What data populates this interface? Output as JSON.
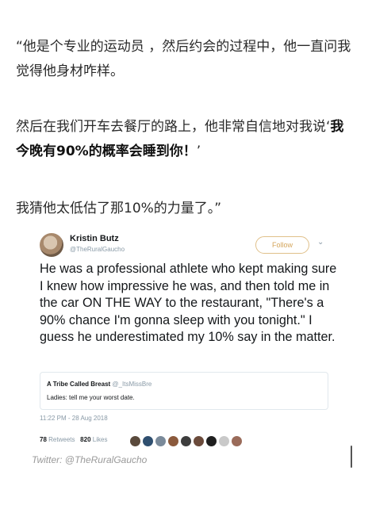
{
  "article": {
    "p1": "“他是个专业的运动员 ，然后约会的过程中，他一直问我觉得他身材咋样。",
    "p2_prefix": "然后在我们开车去餐厅的路上，他非常自信地对我说‘",
    "p2_bold": "我今晚有90%的概率会睡到你！",
    "p2_suffix": "’",
    "p3": "我猜他太低估了那10%的力量了。”"
  },
  "tweet": {
    "author_name": "Kristin Butz",
    "author_handle": "@TheRuralGaucho",
    "follow_label": "Follow",
    "text": "He was a professional athlete who kept making sure I knew how impressive he was, and then told me in the car ON THE WAY to the restaurant, \"There's a 90% chance I'm gonna sleep with you tonight.\" I guess he underestimated my 10% say in the matter.",
    "quoted": {
      "name": "A Tribe Called Breast",
      "handle": "@_ItsMissBre",
      "text": "Ladies: tell me your worst date."
    },
    "timestamp": "11:22 PM - 28 Aug 2018",
    "retweets_count": "78",
    "retweets_label": "Retweets",
    "likes_count": "820",
    "likes_label": "Likes",
    "liker_colors": [
      "#5a4a3c",
      "#2f4f6f",
      "#7a8a9a",
      "#8b5a3c",
      "#3d3d3d",
      "#6b4b3b",
      "#1f1f1f",
      "#c9c9c9",
      "#9a6b5a"
    ]
  },
  "caption": "Twitter: @TheRuralGaucho",
  "icons": {
    "chevron": "chevron-down-icon"
  }
}
